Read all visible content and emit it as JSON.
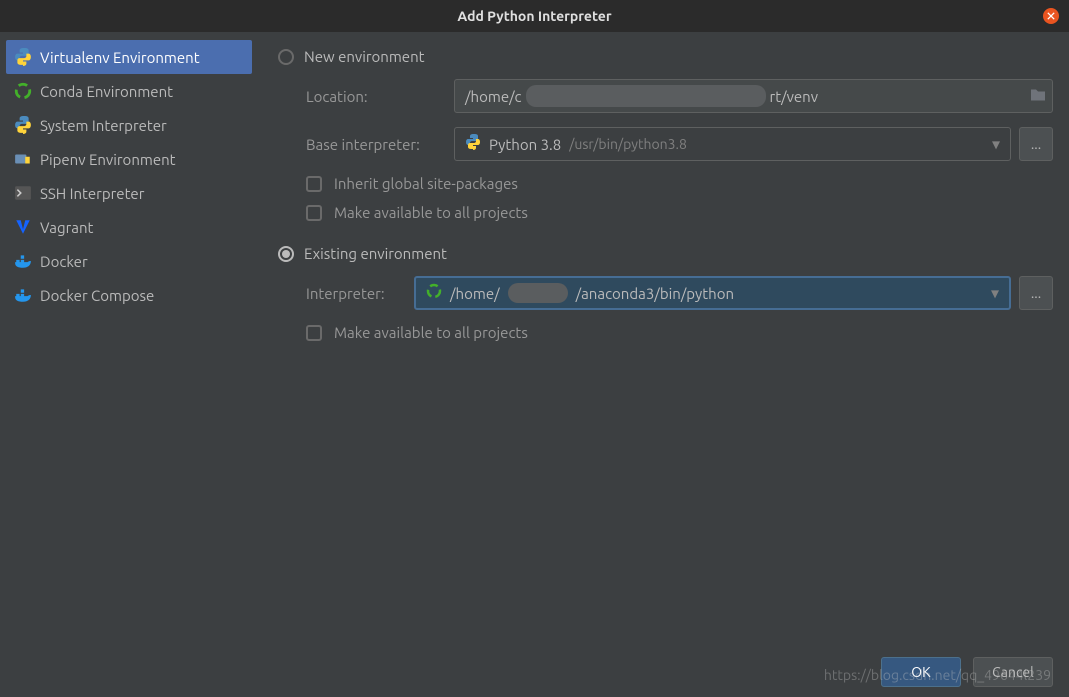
{
  "title": "Add Python Interpreter",
  "sidebar": {
    "items": [
      {
        "label": "Virtualenv Environment",
        "icon": "python-icon"
      },
      {
        "label": "Conda Environment",
        "icon": "conda-icon"
      },
      {
        "label": "System Interpreter",
        "icon": "python-icon"
      },
      {
        "label": "Pipenv Environment",
        "icon": "pipenv-icon"
      },
      {
        "label": "SSH Interpreter",
        "icon": "terminal-icon"
      },
      {
        "label": "Vagrant",
        "icon": "vagrant-icon"
      },
      {
        "label": "Docker",
        "icon": "docker-icon"
      },
      {
        "label": "Docker Compose",
        "icon": "docker-icon"
      }
    ],
    "selectedIndex": 0
  },
  "newEnv": {
    "radioLabel": "New environment",
    "locationLabel": "Location:",
    "locationValue": "/home/c",
    "locationSuffix": "rt/venv",
    "baseLabel": "Base interpreter:",
    "baseMain": "Python 3.8",
    "baseSub": "/usr/bin/python3.8",
    "inheritLabel": "Inherit global site-packages",
    "availableLabel": "Make available to all projects"
  },
  "existingEnv": {
    "radioLabel": "Existing environment",
    "interpLabel": "Interpreter:",
    "interpPrefix": "/home/",
    "interpSuffix": "/anaconda3/bin/python",
    "availableLabel": "Make available to all projects"
  },
  "footer": {
    "ok": "OK",
    "cancel": "Cancel"
  },
  "watermark": "https://blog.csdn.net/qq_49644l239",
  "colors": {
    "accent": "#4b6eaf",
    "close": "#e95420"
  }
}
